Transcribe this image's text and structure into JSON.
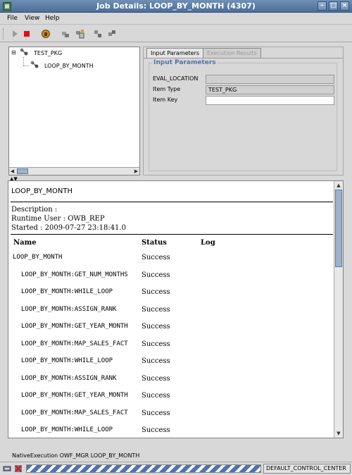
{
  "window": {
    "title": "Job Details: LOOP_BY_MONTH (4307)",
    "controls": [
      "minimize-icon",
      "maximize-icon",
      "close-icon"
    ]
  },
  "menu": [
    {
      "label": "File"
    },
    {
      "label": "View"
    },
    {
      "label": "Help"
    }
  ],
  "toolbar": {
    "icons": [
      "run-icon",
      "stop-icon",
      "lock-icon",
      "expedite-icon",
      "export-icon",
      "relocate-icon",
      "abort-icon"
    ]
  },
  "tree": {
    "root": "TEST_PKG",
    "child": "LOOP_BY_MONTH",
    "expander": "⊟"
  },
  "tabs": [
    {
      "label": "Input Parameters",
      "active": true
    },
    {
      "label": "Execution Results",
      "active": false
    }
  ],
  "input_parameters": {
    "group_title": "Input Parameters",
    "rows": [
      {
        "label": "EVAL_LOCATION",
        "value": ""
      },
      {
        "label": "Item Type",
        "value": "TEST_PKG"
      },
      {
        "label": "Item Key",
        "value": ""
      }
    ]
  },
  "report": {
    "title": "LOOP_BY_MONTH",
    "description": "Description :",
    "runtime_user": "Runtime User : OWB_REP",
    "started": "Started : 2009-07-27 23:18:41.0",
    "headers": {
      "name": "Name",
      "status": "Status",
      "log": "Log"
    },
    "rows": [
      {
        "name": "LOOP_BY_MONTH",
        "status": "Success",
        "indent": false
      },
      {
        "name": "LOOP_BY_MONTH:GET_NUM_MONTHS",
        "status": "Success",
        "indent": true
      },
      {
        "name": "LOOP_BY_MONTH:WHILE_LOOP",
        "status": "Success",
        "indent": true
      },
      {
        "name": "LOOP_BY_MONTH:ASSIGN_RANK",
        "status": "Success",
        "indent": true
      },
      {
        "name": "LOOP_BY_MONTH:GET_YEAR_MONTH",
        "status": "Success",
        "indent": true
      },
      {
        "name": "LOOP_BY_MONTH:MAP_SALES_FACT",
        "status": "Success",
        "indent": true
      },
      {
        "name": "LOOP_BY_MONTH:WHILE_LOOP",
        "status": "Success",
        "indent": true
      },
      {
        "name": "LOOP_BY_MONTH:ASSIGN_RANK",
        "status": "Success",
        "indent": true
      },
      {
        "name": "LOOP_BY_MONTH:GET_YEAR_MONTH",
        "status": "Success",
        "indent": true
      },
      {
        "name": "LOOP_BY_MONTH:MAP_SALES_FACT",
        "status": "Success",
        "indent": true
      },
      {
        "name": "LOOP_BY_MONTH:WHILE_LOOP",
        "status": "Success",
        "indent": true
      }
    ]
  },
  "status_bar": {
    "text": "NativeExecution OWF_MGR LOOP_BY_MONTH",
    "location": "DEFAULT_CONTROL_CENTER"
  },
  "colors": {
    "titlebar": "#4d6e99",
    "accent": "#5273a8",
    "progress": "#4e72b8"
  }
}
